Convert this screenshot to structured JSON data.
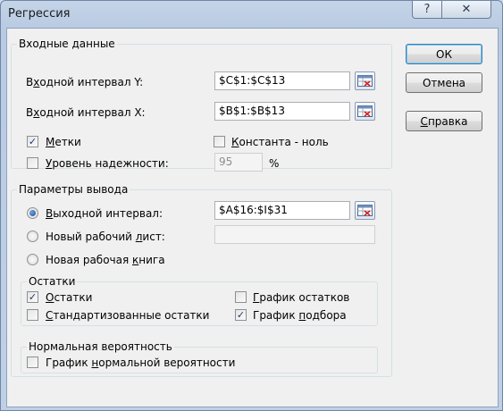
{
  "window": {
    "title": "Регрессия"
  },
  "titlebar": {
    "help_glyph": "?",
    "close_glyph": "✕"
  },
  "input_group": {
    "label": "Входные данные",
    "y_label_pre": "В",
    "y_label_u": "х",
    "y_label_post": "одной интервал Y:",
    "y_value": "$C$1:$C$13",
    "x_label_pre": "В",
    "x_label_u": "х",
    "x_label_post": "одной интервал X:",
    "x_value": "$B$1:$B$13",
    "labels_checkbox": {
      "pre": "",
      "u": "М",
      "post": "етки",
      "checked": true
    },
    "constant_checkbox": {
      "pre": "",
      "u": "К",
      "post": "онстанта - ноль",
      "checked": false
    },
    "confidence_checkbox": {
      "pre": "",
      "u": "У",
      "post": "ровень надежности:",
      "checked": false
    },
    "confidence_value": "95",
    "confidence_unit": "%"
  },
  "output_group": {
    "label": "Параметры вывода",
    "output_range": {
      "pre": "",
      "u": "В",
      "post": "ыходной интервал:",
      "selected": true,
      "value": "$A$16:$I$31"
    },
    "new_sheet": {
      "pre": "Новый рабочий ",
      "u": "л",
      "post": "ист:",
      "selected": false,
      "value": ""
    },
    "new_book": {
      "pre": "Новая рабочая ",
      "u": "к",
      "post": "нига",
      "selected": false
    }
  },
  "residuals_group": {
    "label": "Остатки",
    "residuals": {
      "pre": "",
      "u": "О",
      "post": "статки",
      "checked": true
    },
    "std_residuals": {
      "pre": "",
      "u": "С",
      "post": "тандартизованные остатки",
      "checked": false
    },
    "residual_plot": {
      "pre": "",
      "u": "Г",
      "post": "рафик остатков",
      "checked": false
    },
    "fit_plot": {
      "pre": "График ",
      "u": "п",
      "post": "одбора",
      "checked": true
    }
  },
  "normal_group": {
    "label": "Нормальная вероятность",
    "normal_plot": {
      "pre": "График ",
      "u": "н",
      "post": "ормальной вероятности",
      "checked": false
    }
  },
  "buttons": {
    "ok": "ОК",
    "cancel": "Отмена",
    "help_pre": "",
    "help_u": "С",
    "help_post": "правка"
  },
  "check_glyph": "✓"
}
